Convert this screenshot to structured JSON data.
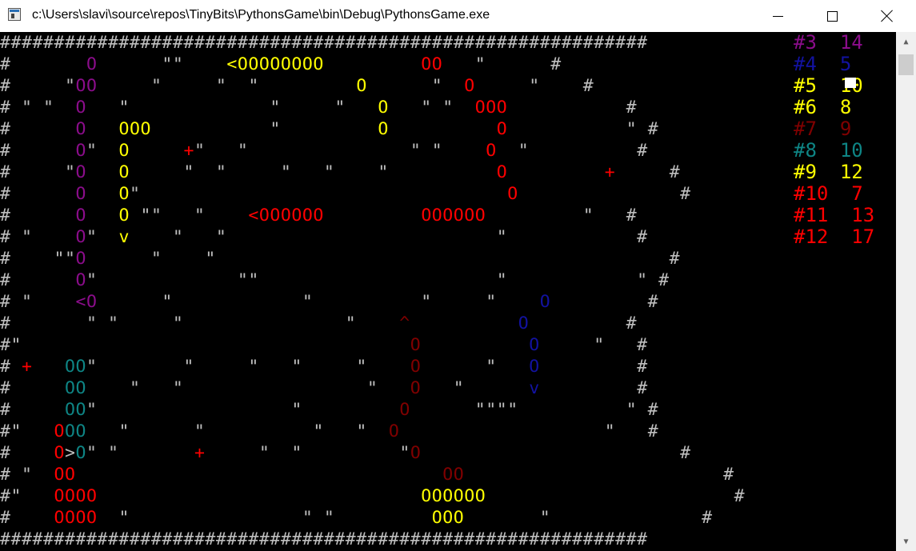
{
  "window": {
    "title": "c:\\Users\\slavi\\source\\repos\\TinyBits\\PythonsGame\\bin\\Debug\\PythonsGame.exe"
  },
  "colors": {
    "w": "#bfbfbf",
    "p": "#8b0d8b",
    "y": "#ffff00",
    "r": "#ff0000",
    "db": "#1212a0",
    "dr": "#800000",
    "t": "#0e8585"
  },
  "scores": [
    {
      "id": "#3",
      "value": "14",
      "color": "p"
    },
    {
      "id": "#4",
      "value": "5",
      "color": "db"
    },
    {
      "id": "#5",
      "value": "10",
      "color": "y"
    },
    {
      "id": "#6",
      "value": "8",
      "color": "y"
    },
    {
      "id": "#7",
      "value": "9",
      "color": "dr"
    },
    {
      "id": "#8",
      "value": "10",
      "color": "t"
    },
    {
      "id": "#9",
      "value": "12",
      "color": "y"
    },
    {
      "id": "#10",
      "value": "7",
      "color": "r"
    },
    {
      "id": "#11",
      "value": "13",
      "color": "r"
    },
    {
      "id": "#12",
      "value": "17",
      "color": "r"
    }
  ],
  "grid": [
    [
      [
        "w",
        "############################################################"
      ]
    ],
    [
      [
        "w",
        "#       "
      ],
      [
        "p",
        "O"
      ],
      [
        "w",
        "      \"\"    "
      ],
      [
        "y",
        "<OOOOOOOO"
      ],
      [
        "w",
        "         "
      ],
      [
        "r",
        "OO"
      ],
      [
        "w",
        "   \"      #"
      ]
    ],
    [
      [
        "w",
        "#     \""
      ],
      [
        "p",
        "OO"
      ],
      [
        "w",
        "     \"     \"  \"         "
      ],
      [
        "y",
        "O"
      ],
      [
        "w",
        "      \"  "
      ],
      [
        "r",
        "O"
      ],
      [
        "w",
        "     \"    #"
      ]
    ],
    [
      [
        "w",
        "# \" \"  "
      ],
      [
        "p",
        "O"
      ],
      [
        "w",
        "   \"             \"     \"   "
      ],
      [
        "y",
        "O"
      ],
      [
        "w",
        "   \" \"  "
      ],
      [
        "r",
        "OOO"
      ],
      [
        "w",
        "           #"
      ]
    ],
    [
      [
        "w",
        "#      "
      ],
      [
        "p",
        "O"
      ],
      [
        "w",
        "   "
      ],
      [
        "y",
        "OOO"
      ],
      [
        "w",
        "           \"         "
      ],
      [
        "y",
        "O"
      ],
      [
        "w",
        "          "
      ],
      [
        "r",
        "O"
      ],
      [
        "w",
        "           \" #"
      ]
    ],
    [
      [
        "w",
        "#      "
      ],
      [
        "p",
        "O"
      ],
      [
        "w",
        "\"  "
      ],
      [
        "y",
        "O"
      ],
      [
        "w",
        "     "
      ],
      [
        "r",
        "+"
      ],
      [
        "w",
        "\"   \"               \" \"    "
      ],
      [
        "r",
        "O"
      ],
      [
        "w",
        "  \"          #"
      ]
    ],
    [
      [
        "w",
        "#     \""
      ],
      [
        "p",
        "O"
      ],
      [
        "w",
        "   "
      ],
      [
        "y",
        "O"
      ],
      [
        "w",
        "     \"  \"     \"   \"    \"          "
      ],
      [
        "r",
        "O"
      ],
      [
        "w",
        "         "
      ],
      [
        "r",
        "+"
      ],
      [
        "w",
        "     #"
      ]
    ],
    [
      [
        "w",
        "#      "
      ],
      [
        "p",
        "O"
      ],
      [
        "w",
        "   "
      ],
      [
        "y",
        "O"
      ],
      [
        "w",
        "\"                                  "
      ],
      [
        "r",
        "O"
      ],
      [
        "w",
        "               #"
      ]
    ],
    [
      [
        "w",
        "#      "
      ],
      [
        "p",
        "O"
      ],
      [
        "w",
        "   "
      ],
      [
        "y",
        "O"
      ],
      [
        "w",
        " \"\"   \"    "
      ],
      [
        "r",
        "<OOOOOO"
      ],
      [
        "w",
        "         "
      ],
      [
        "r",
        "OOOOOO"
      ],
      [
        "w",
        "         \"   #"
      ]
    ],
    [
      [
        "w",
        "# \"    "
      ],
      [
        "p",
        "O"
      ],
      [
        "w",
        "\"  "
      ],
      [
        "y",
        "v"
      ],
      [
        "w",
        "    \"   \"                         \"            #"
      ]
    ],
    [
      [
        "w",
        "#    \"\""
      ],
      [
        "p",
        "O"
      ],
      [
        "w",
        "      \"    \"                                          #"
      ]
    ],
    [
      [
        "w",
        "#      "
      ],
      [
        "p",
        "O"
      ],
      [
        "w",
        "\"             \"\"                      \"            \" #"
      ]
    ],
    [
      [
        "w",
        "# \"    "
      ],
      [
        "p",
        "<O"
      ],
      [
        "w",
        "      \"            \"          \"     \"    "
      ],
      [
        "db",
        "O"
      ],
      [
        "w",
        "         #"
      ]
    ],
    [
      [
        "w",
        "#       \" \"     \"               \"    "
      ],
      [
        "dr",
        "^"
      ],
      [
        "w",
        "          "
      ],
      [
        "db",
        "O"
      ],
      [
        "w",
        "         #"
      ]
    ],
    [
      [
        "w",
        "#\"                                    "
      ],
      [
        "dr",
        "O"
      ],
      [
        "w",
        "          "
      ],
      [
        "db",
        "O"
      ],
      [
        "w",
        "     \"   #"
      ]
    ],
    [
      [
        "w",
        "# "
      ],
      [
        "r",
        "+"
      ],
      [
        "w",
        "   "
      ],
      [
        "t",
        "OO"
      ],
      [
        "w",
        "\"        \"     \"   \"     \"    "
      ],
      [
        "dr",
        "O"
      ],
      [
        "w",
        "      \"   "
      ],
      [
        "db",
        "O"
      ],
      [
        "w",
        "         #"
      ]
    ],
    [
      [
        "w",
        "#     "
      ],
      [
        "t",
        "OO"
      ],
      [
        "w",
        "    \"   \"                 \"   "
      ],
      [
        "dr",
        "O"
      ],
      [
        "w",
        "   \"      "
      ],
      [
        "db",
        "v"
      ],
      [
        "w",
        "         #"
      ]
    ],
    [
      [
        "w",
        "#     "
      ],
      [
        "t",
        "OO"
      ],
      [
        "w",
        "\"                  \"         "
      ],
      [
        "dr",
        "O"
      ],
      [
        "w",
        "      \"\"\"\"          \" #"
      ]
    ],
    [
      [
        "w",
        "#\"   "
      ],
      [
        "r",
        "O"
      ],
      [
        "t",
        "OO"
      ],
      [
        "w",
        "   \"      \"          \"   \"  "
      ],
      [
        "dr",
        "O"
      ],
      [
        "w",
        "                   \"   #"
      ]
    ],
    [
      [
        "w",
        "#    "
      ],
      [
        "r",
        "O"
      ],
      [
        "w",
        ">"
      ],
      [
        "t",
        "O"
      ],
      [
        "w",
        "\" \"       "
      ],
      [
        "r",
        "+"
      ],
      [
        "w",
        "     \"  \"         \""
      ],
      [
        "dr",
        "O"
      ],
      [
        "w",
        "                        #"
      ]
    ],
    [
      [
        "w",
        "# \"  "
      ],
      [
        "r",
        "OO"
      ],
      [
        "w",
        "                                  "
      ],
      [
        "dr",
        "OO"
      ],
      [
        "w",
        "                        #"
      ]
    ],
    [
      [
        "w",
        "#\"   "
      ],
      [
        "r",
        "OOOO"
      ],
      [
        "w",
        "                              "
      ],
      [
        "y",
        "OOOOOO"
      ],
      [
        "w",
        "                       #"
      ]
    ],
    [
      [
        "w",
        "#    "
      ],
      [
        "r",
        "OOOO"
      ],
      [
        "w",
        "  \"                \" \"         "
      ],
      [
        "y",
        "OOO"
      ],
      [
        "w",
        "       \"              #"
      ]
    ],
    [
      [
        "w",
        "############################################################"
      ]
    ]
  ]
}
